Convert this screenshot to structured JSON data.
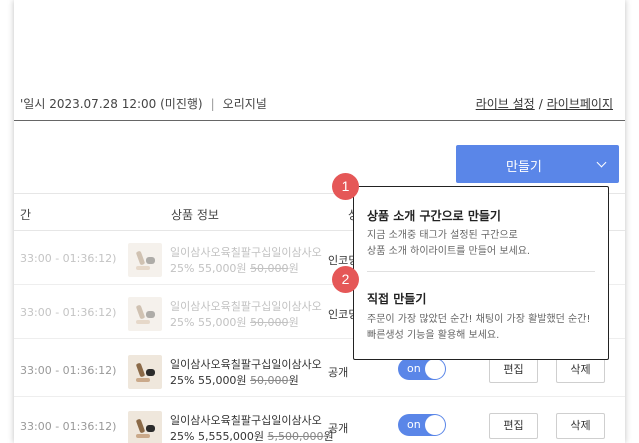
{
  "broadcast": {
    "info_prefix": "'일시 2023.07.28 12:00 (미진행)",
    "separator": "|",
    "type": "오리지널"
  },
  "links": {
    "live_settings": "라이브 설정",
    "slash": "/",
    "live_page": "라이브페이지"
  },
  "make_button": {
    "label": "만들기"
  },
  "table": {
    "headers": [
      "간",
      "상품 정보",
      "상"
    ],
    "rows": [
      {
        "time": "33:00 - 01:36:12)",
        "name": "일이삼사오육칠팔구십일이삼사오",
        "price_prefix": "25% 55,000원 ",
        "price_original": "50,000",
        "price_suffix": "원",
        "status": "인코딩",
        "dim": true
      },
      {
        "time": "33:00 - 01:36:12)",
        "name": "일이삼사오육칠팔구십일이삼사오",
        "price_prefix": "25% 55,000원 ",
        "price_original": "50,000",
        "price_suffix": "원",
        "status": "인코딩",
        "dim": true
      },
      {
        "time": "33:00 - 01:36:12)",
        "name": "일이삼사오육칠팔구십일이삼사오",
        "price_prefix": "25% 55,000원 ",
        "price_original": "50,000",
        "price_suffix": "원",
        "status": "공개",
        "dim": false,
        "toggle": "on",
        "edit": "편집",
        "delete": "삭제"
      },
      {
        "time": "33:00 - 01:36:12)",
        "name": "일이삼사오육칠팔구십일이삼사오",
        "price_prefix": "25% 5,555,000원 ",
        "price_original": "5,500,000",
        "price_suffix": "원",
        "status": "공개",
        "dim": false,
        "toggle": "on",
        "edit": "편집",
        "delete": "삭제"
      }
    ]
  },
  "dropdown": {
    "options": [
      {
        "number": "1",
        "title": "상품 소개 구간으로 만들기",
        "desc_line1": "지금 소개중 태그가 설정된 구간으로",
        "desc_line2": "상품 소개 하이라이트를 만들어 보세요."
      },
      {
        "number": "2",
        "title": "직접 만들기",
        "desc_line1": "주문이 가장 많았던 순간! 채팅이 가장 활발했던 순간!",
        "desc_line2": "빠른생성 기능을 활용해 보세요."
      }
    ]
  },
  "colors": {
    "accent": "#5a86e8",
    "badge": "#e55757"
  }
}
